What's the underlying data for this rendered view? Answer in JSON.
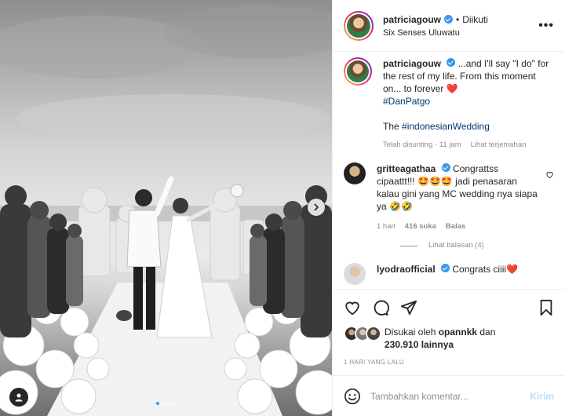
{
  "post": {
    "dots_count": 4,
    "active_dot": 0
  },
  "header": {
    "username": "patriciagouw",
    "separator": "•",
    "follow_status": "Diikuti",
    "location": "Six Senses Uluwatu",
    "more_icon": "•••"
  },
  "caption": {
    "username": "patriciagouw",
    "text": "...and I'll say \"I do\" for the rest of my life. From this moment on... to forever",
    "emoji": "❤️",
    "hashtag1": "#DanPatgo",
    "line2_prefix": "The ",
    "hashtag2": "#indonesianWedding",
    "edited": "Telah disunting · 11 jam",
    "translate": "Lihat terjemahan"
  },
  "comments": [
    {
      "username": "gritteagathaa",
      "text": "Congrattss cipaattt!!! 🤩🤩🤩 jadi penasaran kalau gini yang MC wedding nya siapa ya 🤣🤣",
      "time": "1 hari",
      "likes": "416 suka",
      "reply": "Balas",
      "view_replies": "Lihat balasan (4)"
    },
    {
      "username": "lyodraofficial",
      "text": "Congrats ciiii❤️"
    }
  ],
  "actions": {
    "liked_by_prefix": "Disukai oleh ",
    "liked_by_user": "opannkk",
    "liked_by_mid": " dan",
    "likes_count": "230.910 lainnya",
    "date": "1 HARI YANG LALU"
  },
  "add_comment": {
    "placeholder": "Tambahkan komentar...",
    "send": "Kirim"
  },
  "colors": {
    "accent": "#3897f0",
    "send_disabled": "#b2dffc",
    "heart": "#ed4956"
  }
}
